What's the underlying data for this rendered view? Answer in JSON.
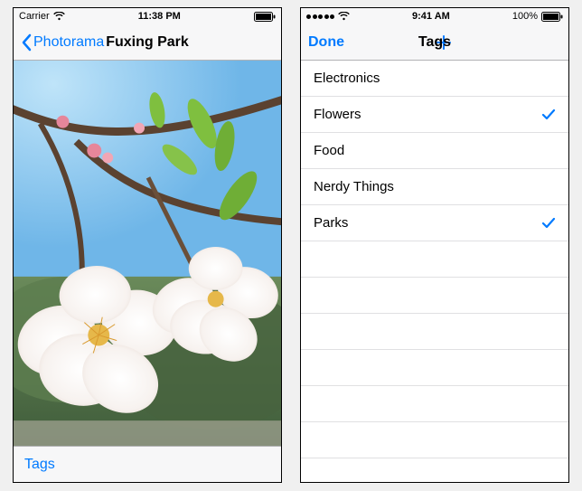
{
  "left_screen": {
    "status": {
      "carrier": "Carrier",
      "time": "11:38 PM"
    },
    "nav": {
      "back_label": "Photorama",
      "title": "Fuxing Park"
    },
    "toolbar": {
      "tags_label": "Tags"
    }
  },
  "right_screen": {
    "status": {
      "time": "9:41 AM",
      "battery_pct": "100%"
    },
    "nav": {
      "done_label": "Done",
      "title": "Tags"
    },
    "tags": [
      {
        "label": "Electronics",
        "checked": false
      },
      {
        "label": "Flowers",
        "checked": true
      },
      {
        "label": "Food",
        "checked": false
      },
      {
        "label": "Nerdy Things",
        "checked": false
      },
      {
        "label": "Parks",
        "checked": true
      }
    ]
  }
}
